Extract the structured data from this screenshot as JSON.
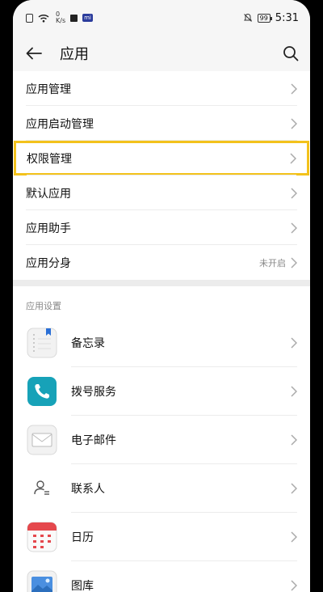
{
  "status": {
    "net_speed_value": "0",
    "net_speed_unit": "K/s",
    "chip_label": "mi",
    "battery": "99",
    "time": "5:31"
  },
  "header": {
    "title": "应用"
  },
  "menu": [
    {
      "label": "应用管理",
      "extra": ""
    },
    {
      "label": "应用启动管理",
      "extra": ""
    },
    {
      "label": "权限管理",
      "extra": ""
    },
    {
      "label": "默认应用",
      "extra": ""
    },
    {
      "label": "应用助手",
      "extra": ""
    },
    {
      "label": "应用分身",
      "extra": "未开启"
    }
  ],
  "section": {
    "title": "应用设置"
  },
  "apps": [
    {
      "label": "备忘录",
      "icon": "memo-icon"
    },
    {
      "label": "拨号服务",
      "icon": "phone-icon"
    },
    {
      "label": "电子邮件",
      "icon": "mail-icon"
    },
    {
      "label": "联系人",
      "icon": "contacts-icon"
    },
    {
      "label": "日历",
      "icon": "calendar-icon"
    },
    {
      "label": "图库",
      "icon": "gallery-icon"
    }
  ],
  "colors": {
    "highlight": "#f3c21c",
    "phone_app": "#17a2b8",
    "calendar_red": "#e5484d"
  }
}
